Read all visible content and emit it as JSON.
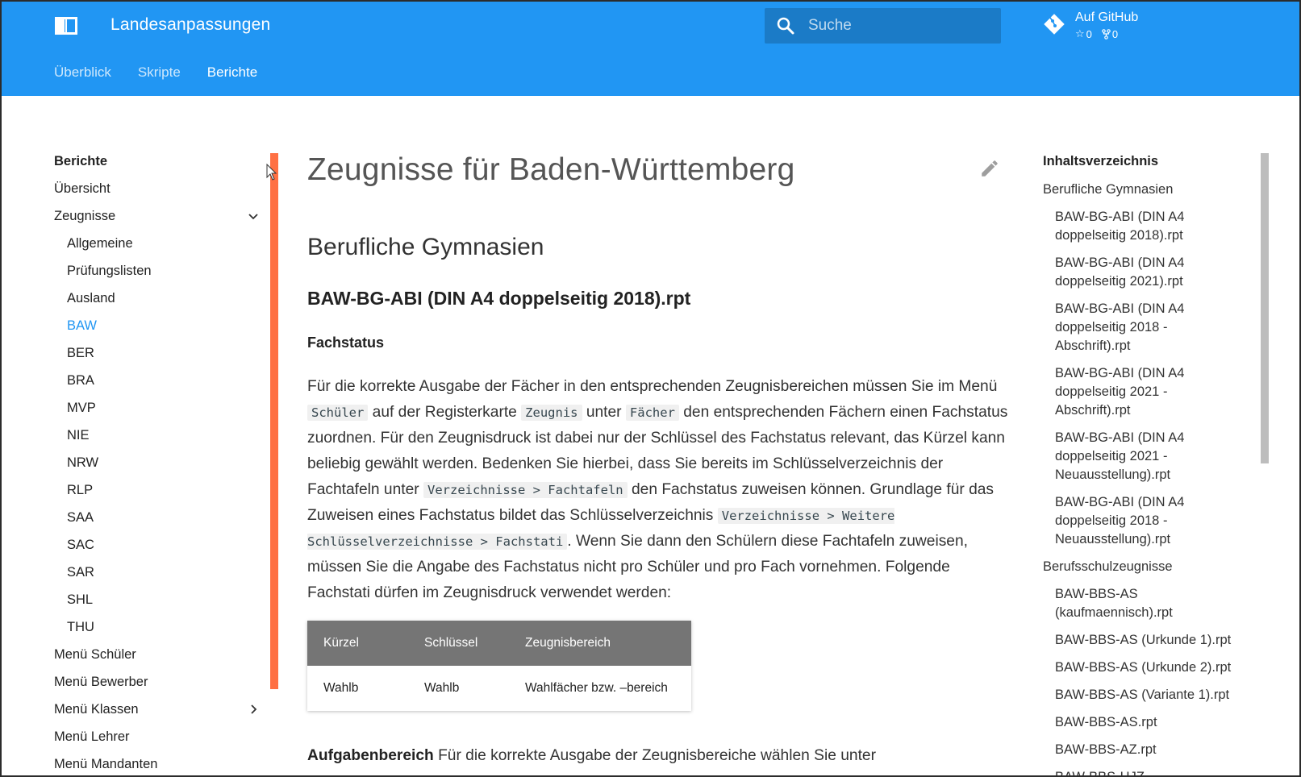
{
  "header": {
    "site_title": "Landesanpassungen",
    "search_placeholder": "Suche",
    "repo_name": "Auf GitHub",
    "repo_stars": "0",
    "repo_forks": "0"
  },
  "tabs": [
    {
      "label": "Überblick"
    },
    {
      "label": "Skripte"
    },
    {
      "label": "Berichte"
    }
  ],
  "nav": {
    "title": "Berichte",
    "items": [
      {
        "label": "Übersicht"
      },
      {
        "label": "Zeugnisse"
      },
      {
        "label": "Allgemeine"
      },
      {
        "label": "Prüfungslisten"
      },
      {
        "label": "Ausland"
      },
      {
        "label": "BAW"
      },
      {
        "label": "BER"
      },
      {
        "label": "BRA"
      },
      {
        "label": "MVP"
      },
      {
        "label": "NIE"
      },
      {
        "label": "NRW"
      },
      {
        "label": "RLP"
      },
      {
        "label": "SAA"
      },
      {
        "label": "SAC"
      },
      {
        "label": "SAR"
      },
      {
        "label": "SHL"
      },
      {
        "label": "THU"
      },
      {
        "label": "Menü Schüler"
      },
      {
        "label": "Menü Bewerber"
      },
      {
        "label": "Menü Klassen"
      },
      {
        "label": "Menü Lehrer"
      },
      {
        "label": "Menü Mandanten"
      }
    ]
  },
  "content": {
    "page_title": "Zeugnisse für Baden-Württemberg",
    "h2": "Berufliche Gymnasien",
    "h3": "BAW-BG-ABI (DIN A4 doppelseitig 2018).rpt",
    "h4": "Fachstatus",
    "para": {
      "t1": "Für die korrekte Ausgabe der Fächer in den entsprechenden Zeugnisbereichen müssen Sie im Menü ",
      "code1": "Schüler",
      "t2": " auf der Registerkarte ",
      "code2": "Zeugnis",
      "t3": " unter ",
      "code3": "Fächer",
      "t4": " den entsprechenden Fächern einen Fachstatus zuordnen. Für den Zeugnisdruck ist dabei nur der Schlüssel des Fachstatus relevant, das Kürzel kann beliebig gewählt werden. Bedenken Sie hierbei, dass Sie bereits im Schlüsselverzeichnis der Fachtafeln unter ",
      "code4": "Verzeichnisse > Fachtafeln",
      "t5": " den Fachstatus zuweisen können. Grundlage für das Zuweisen eines Fachstatus bildet das Schlüsselverzeichnis ",
      "code5": "Verzeichnisse > Weitere Schlüsselverzeichnisse > Fachstati",
      "t6": ". Wenn Sie dann den Schülern diese Fachtafeln zuweisen, müssen Sie die Angabe des Fachstatus nicht pro Schüler und pro Fach vornehmen. Folgende Fachstati dürfen im Zeugnisdruck verwendet werden:"
    },
    "table": {
      "headers": [
        "Kürzel",
        "Schlüssel",
        "Zeugnisbereich"
      ],
      "rows": [
        [
          "Wahlb",
          "Wahlb",
          "Wahlfächer bzw. –bereich"
        ]
      ]
    },
    "bottom": {
      "bold": "Aufgabenbereich",
      "text": " Für die korrekte Ausgabe der Zeugnisbereiche wählen Sie unter"
    }
  },
  "toc": {
    "title": "Inhaltsverzeichnis",
    "items": [
      {
        "label": "Berufliche Gymnasien"
      },
      {
        "label": "BAW-BG-ABI (DIN A4 doppelseitig 2018).rpt"
      },
      {
        "label": "BAW-BG-ABI (DIN A4 doppelseitig 2021).rpt"
      },
      {
        "label": "BAW-BG-ABI (DIN A4 doppelseitig 2018 - Abschrift).rpt"
      },
      {
        "label": "BAW-BG-ABI (DIN A4 doppelseitig 2021 - Abschrift).rpt"
      },
      {
        "label": "BAW-BG-ABI (DIN A4 doppelseitig 2021 - Neuausstellung).rpt"
      },
      {
        "label": "BAW-BG-ABI (DIN A4 doppelseitig 2018 - Neuausstellung).rpt"
      },
      {
        "label": "Berufsschulzeugnisse"
      },
      {
        "label": "BAW-BBS-AS (kaufmaennisch).rpt"
      },
      {
        "label": "BAW-BBS-AS (Urkunde 1).rpt"
      },
      {
        "label": "BAW-BBS-AS (Urkunde 2).rpt"
      },
      {
        "label": "BAW-BBS-AS (Variante 1).rpt"
      },
      {
        "label": "BAW-BBS-AS.rpt"
      },
      {
        "label": "BAW-BBS-AZ.rpt"
      },
      {
        "label": "BAW-BBS-HJZ"
      }
    ]
  },
  "colors": {
    "primary": "#2196f3",
    "accent": "#ff7043",
    "table_header": "#757575"
  }
}
